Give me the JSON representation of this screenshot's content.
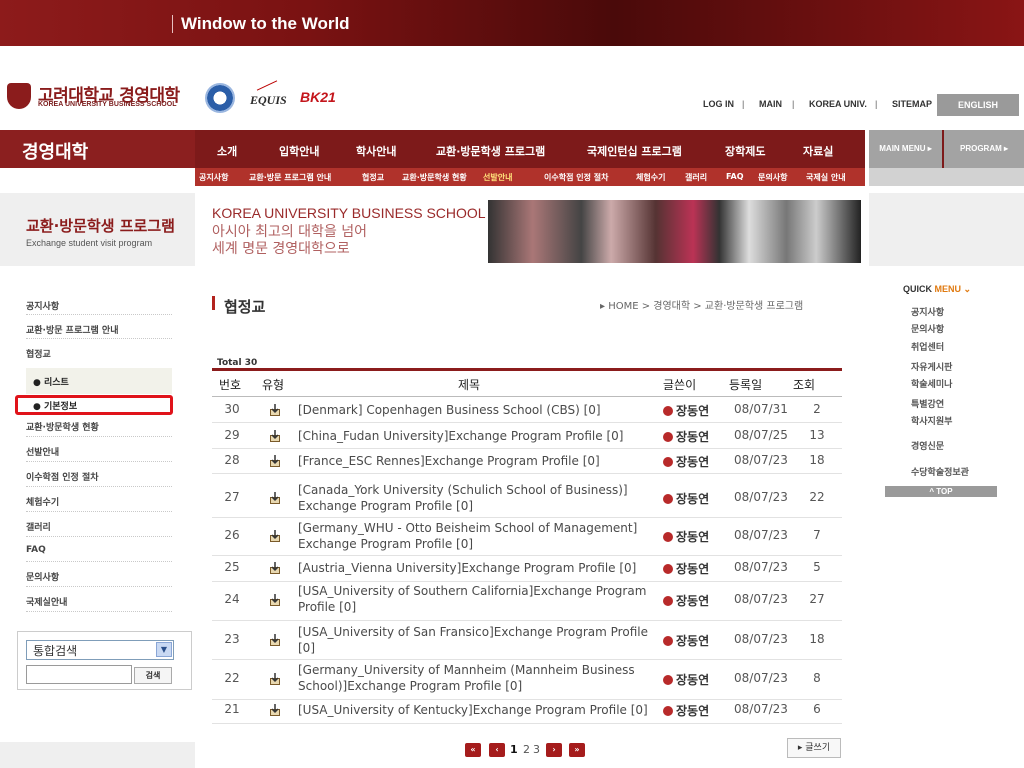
{
  "banner": {
    "title": "Window to the World"
  },
  "header": {
    "logo_kor": "고려대학교 경영대학",
    "logo_eng": "KOREA UNIVERSITY BUSINESS SCHOOL",
    "equis": "EQUIS",
    "bk": "BK21",
    "links": [
      "LOG IN",
      "MAIN",
      "KOREA UNIV.",
      "SITEMAP"
    ],
    "english": "ENGLISH"
  },
  "nav": {
    "home": "경영대학",
    "items": [
      "소개",
      "입학안내",
      "학사안내",
      "교환·방문학생 프로그램",
      "국제인턴십 프로그램",
      "장학제도",
      "자료실"
    ],
    "main_menu": "MAIN MENU ▸",
    "program": "PROGRAM ▸"
  },
  "subnav": [
    "공지사항",
    "교환·방문 프로그램 안내",
    "협정교",
    "교환·방문학생 현황",
    "선발안내",
    "이수학점 인정 절차",
    "체험수기",
    "갤러리",
    "FAQ",
    "문의사항",
    "국제실 안내"
  ],
  "hero": {
    "title": "교환·방문학생 프로그램",
    "subtitle": "Exchange student visit program",
    "line1": "KOREA UNIVERSITY BUSINESS SCHOOL",
    "line2": "아시아 최고의 대학을 넘어",
    "line3": "세계 명문 경영대학으로"
  },
  "sidebar": {
    "items": [
      "공지사항",
      "교환·방문 프로그램 안내",
      "협정교",
      "교환·방문학생 현황",
      "선발안내",
      "이수학점 인정 절차",
      "체험수기",
      "갤러리",
      "FAQ",
      "문의사항",
      "국제실안내"
    ],
    "sub_items": [
      "● 리스트",
      "● 기본정보"
    ],
    "search_select": "통합검색",
    "search_button": "검색"
  },
  "main": {
    "title": "협정교",
    "breadcrumb": "▸ HOME > 경영대학 > 교환·방문학생 프로그램",
    "total": "Total 30",
    "headers": [
      "번호",
      "유형",
      "제목",
      "글쓴이",
      "등록일",
      "조회"
    ],
    "rows": [
      {
        "no": "30",
        "subject": "[Denmark] Copenhagen Business School (CBS) [0]",
        "writer": "장동연",
        "date": "08/07/31",
        "views": "2"
      },
      {
        "no": "29",
        "subject": "[China_Fudan University]Exchange Program Profile [0]",
        "writer": "장동연",
        "date": "08/07/25",
        "views": "13"
      },
      {
        "no": "28",
        "subject": "[France_ESC Rennes]Exchange Program Profile [0]",
        "writer": "장동연",
        "date": "08/07/23",
        "views": "18"
      },
      {
        "no": "27",
        "subject": "[Canada_York University (Schulich School of Business)] Exchange Program Profile [0]",
        "writer": "장동연",
        "date": "08/07/23",
        "views": "22"
      },
      {
        "no": "26",
        "subject": "[Germany_WHU - Otto Beisheim School of Management] Exchange Program Profile [0]",
        "writer": "장동연",
        "date": "08/07/23",
        "views": "7"
      },
      {
        "no": "25",
        "subject": "[Austria_Vienna University]Exchange Program Profile [0]",
        "writer": "장동연",
        "date": "08/07/23",
        "views": "5"
      },
      {
        "no": "24",
        "subject": "[USA_University of Southern California]Exchange Program Profile [0]",
        "writer": "장동연",
        "date": "08/07/23",
        "views": "27"
      },
      {
        "no": "23",
        "subject": "[USA_University of San Fransico]Exchange Program Profile [0]",
        "writer": "장동연",
        "date": "08/07/23",
        "views": "18"
      },
      {
        "no": "22",
        "subject": "[Germany_University of Mannheim (Mannheim Business School)]Exchange Program Profile [0]",
        "writer": "장동연",
        "date": "08/07/23",
        "views": "8"
      },
      {
        "no": "21",
        "subject": "[USA_University of Kentucky]Exchange Program Profile [0]",
        "writer": "장동연",
        "date": "08/07/23",
        "views": "6"
      }
    ],
    "pages": [
      "1",
      "2",
      "3"
    ],
    "write_button": "▸ 글쓰기"
  },
  "quick_menu": {
    "title_a": "QUICK ",
    "title_b": "MENU",
    "items": [
      "공지사항",
      "문의사항",
      "취업센터",
      "자유게시판",
      "학술세미나",
      "특별강연",
      "학사지원부",
      "경영신문",
      "수당학술정보관"
    ],
    "top": "^ TOP"
  }
}
